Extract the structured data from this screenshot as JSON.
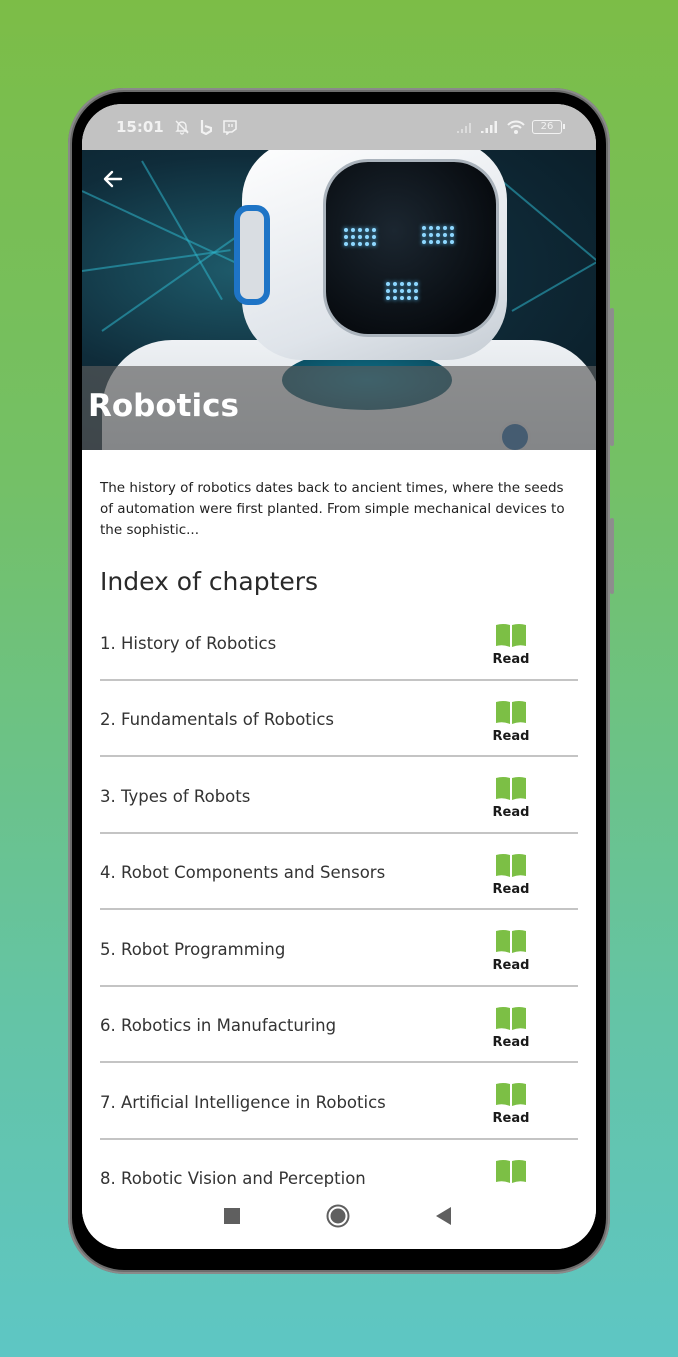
{
  "status_bar": {
    "time": "15:01",
    "notification_icons": [
      "bell-off-icon",
      "bing-icon",
      "twitch-icon"
    ],
    "system_icons": [
      "signal-weak-icon",
      "signal-icon",
      "wifi-icon"
    ],
    "battery": "26"
  },
  "header": {
    "back_icon": "arrow-left-icon",
    "title": "Robotics",
    "image": "robot-hero-image"
  },
  "intro": {
    "text": "The history of robotics dates back to ancient times, where the seeds of automation were first planted. From simple mechanical devices to the sophistic..."
  },
  "chapters_section": {
    "title": "Index of chapters",
    "read_label": "Read",
    "read_icon": "open-book-icon",
    "items": [
      {
        "title": "1. History of Robotics"
      },
      {
        "title": "2. Fundamentals of Robotics"
      },
      {
        "title": "3. Types of Robots"
      },
      {
        "title": "4. Robot Components and Sensors"
      },
      {
        "title": "5. Robot Programming"
      },
      {
        "title": "6. Robotics in Manufacturing"
      },
      {
        "title": "7. Artificial Intelligence in Robotics"
      },
      {
        "title": "8. Robotic Vision and Perception"
      }
    ]
  },
  "nav_bar": {
    "buttons": [
      "recent-apps",
      "home",
      "back"
    ]
  },
  "colors": {
    "accent_green": "#7cbf45",
    "background_top": "#7cbd47",
    "background_bottom": "#5ec6c4"
  }
}
